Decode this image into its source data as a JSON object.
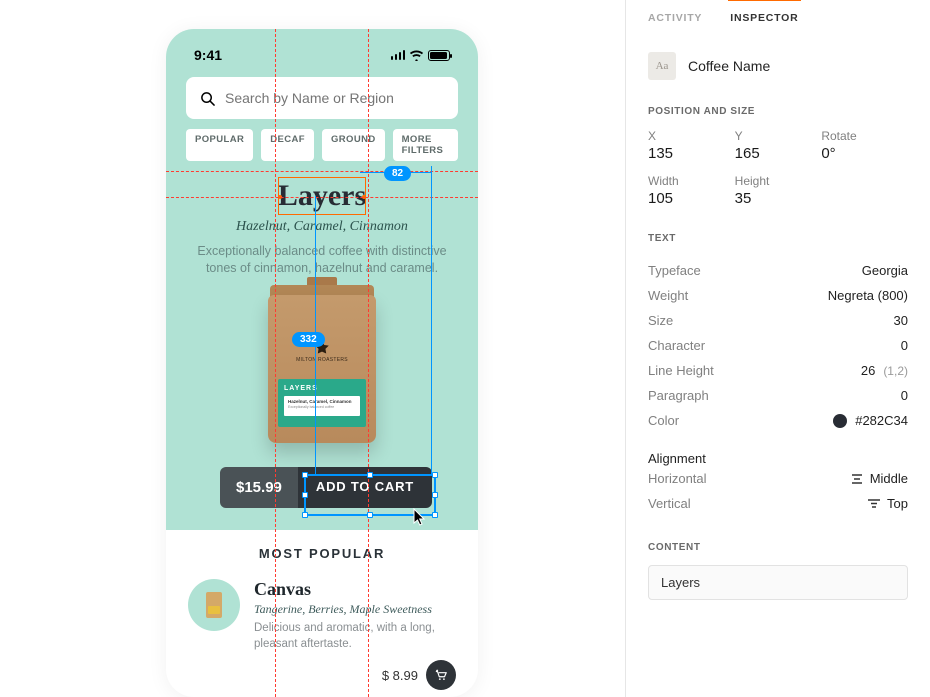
{
  "inspector": {
    "tabs": {
      "activity": "ACTIVITY",
      "inspector": "INSPECTOR"
    },
    "layer": {
      "thumb_glyph": "Aa",
      "name": "Coffee Name"
    },
    "position_section": "POSITION AND SIZE",
    "position": {
      "x_label": "X",
      "x": "135",
      "y_label": "Y",
      "y": "165",
      "rotate_label": "Rotate",
      "rotate": "0°",
      "w_label": "Width",
      "w": "105",
      "h_label": "Height",
      "h": "35"
    },
    "text_section": "TEXT",
    "text": {
      "typeface_k": "Typeface",
      "typeface_v": "Georgia",
      "weight_k": "Weight",
      "weight_v": "Negreta (800)",
      "size_k": "Size",
      "size_v": "30",
      "char_k": "Character",
      "char_v": "0",
      "lh_k": "Line Height",
      "lh_v": "26",
      "lh_alt": "(1,2)",
      "para_k": "Paragraph",
      "para_v": "0",
      "color_k": "Color",
      "color_v": "#282C34"
    },
    "alignment_head": "Alignment",
    "alignment": {
      "h_k": "Horizontal",
      "h_v": "Middle",
      "v_k": "Vertical",
      "v_v": "Top"
    },
    "content_section": "CONTENT",
    "content_value": "Layers"
  },
  "phone": {
    "time": "9:41",
    "search_placeholder": "Search by Name or Region",
    "filters": {
      "popular": "POPULAR",
      "decaf": "DECAF",
      "ground": "GROUND",
      "more": "MORE FILTERS"
    },
    "product": {
      "title": "Layers",
      "subtitle": "Hazelnut, Caramel, Cinnamon",
      "desc": "Exceptionally balanced coffee with distinctive tones of cinnamon, hazelnut and caramel.",
      "bag_brand": "MILTON ROASTERS",
      "bag_label_name": "LAYERS",
      "bag_label_line1": "Hazelnut, Caramel, Cinnamon",
      "bag_label_line2": "Exceptionally balanced coffee",
      "price": "$15.99",
      "add": "ADD TO CART"
    },
    "most_popular": "MOST POPULAR",
    "popular_item": {
      "title": "Canvas",
      "subtitle": "Tangerine, Berries, Maple Sweetness",
      "desc": "Delicious and aromatic, with a long, pleasant aftertaste.",
      "price": "$ 8.99"
    }
  },
  "measurements": {
    "gap_right": "82",
    "gap_vert": "332"
  }
}
